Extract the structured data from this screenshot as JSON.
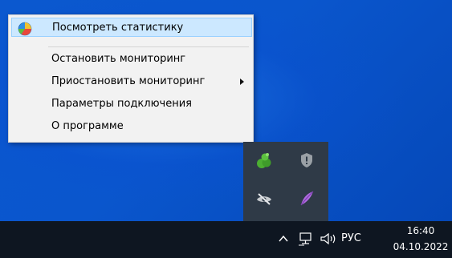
{
  "context_menu": {
    "items": [
      {
        "label": "Посмотреть статистику",
        "icon": "pie-chart-icon",
        "highlighted": true
      },
      {
        "label": "Остановить мониторинг"
      },
      {
        "label": "Приостановить мониторинг",
        "has_submenu": true
      },
      {
        "label": "Параметры подключения"
      },
      {
        "label": "О программе"
      }
    ]
  },
  "tray_overflow": {
    "icons": [
      "green-shield-icon",
      "gray-shield-icon",
      "eye-slash-icon",
      "feather-icon"
    ]
  },
  "taskbar": {
    "language": "РУС",
    "time": "16:40",
    "date": "04.10.2022"
  },
  "colors": {
    "desktop": "#0b53c7",
    "menu_background": "#f2f2f2",
    "menu_highlight": "#cce8ff",
    "taskbar": "#0e1621",
    "tray_flyout": "#2f3a47"
  }
}
